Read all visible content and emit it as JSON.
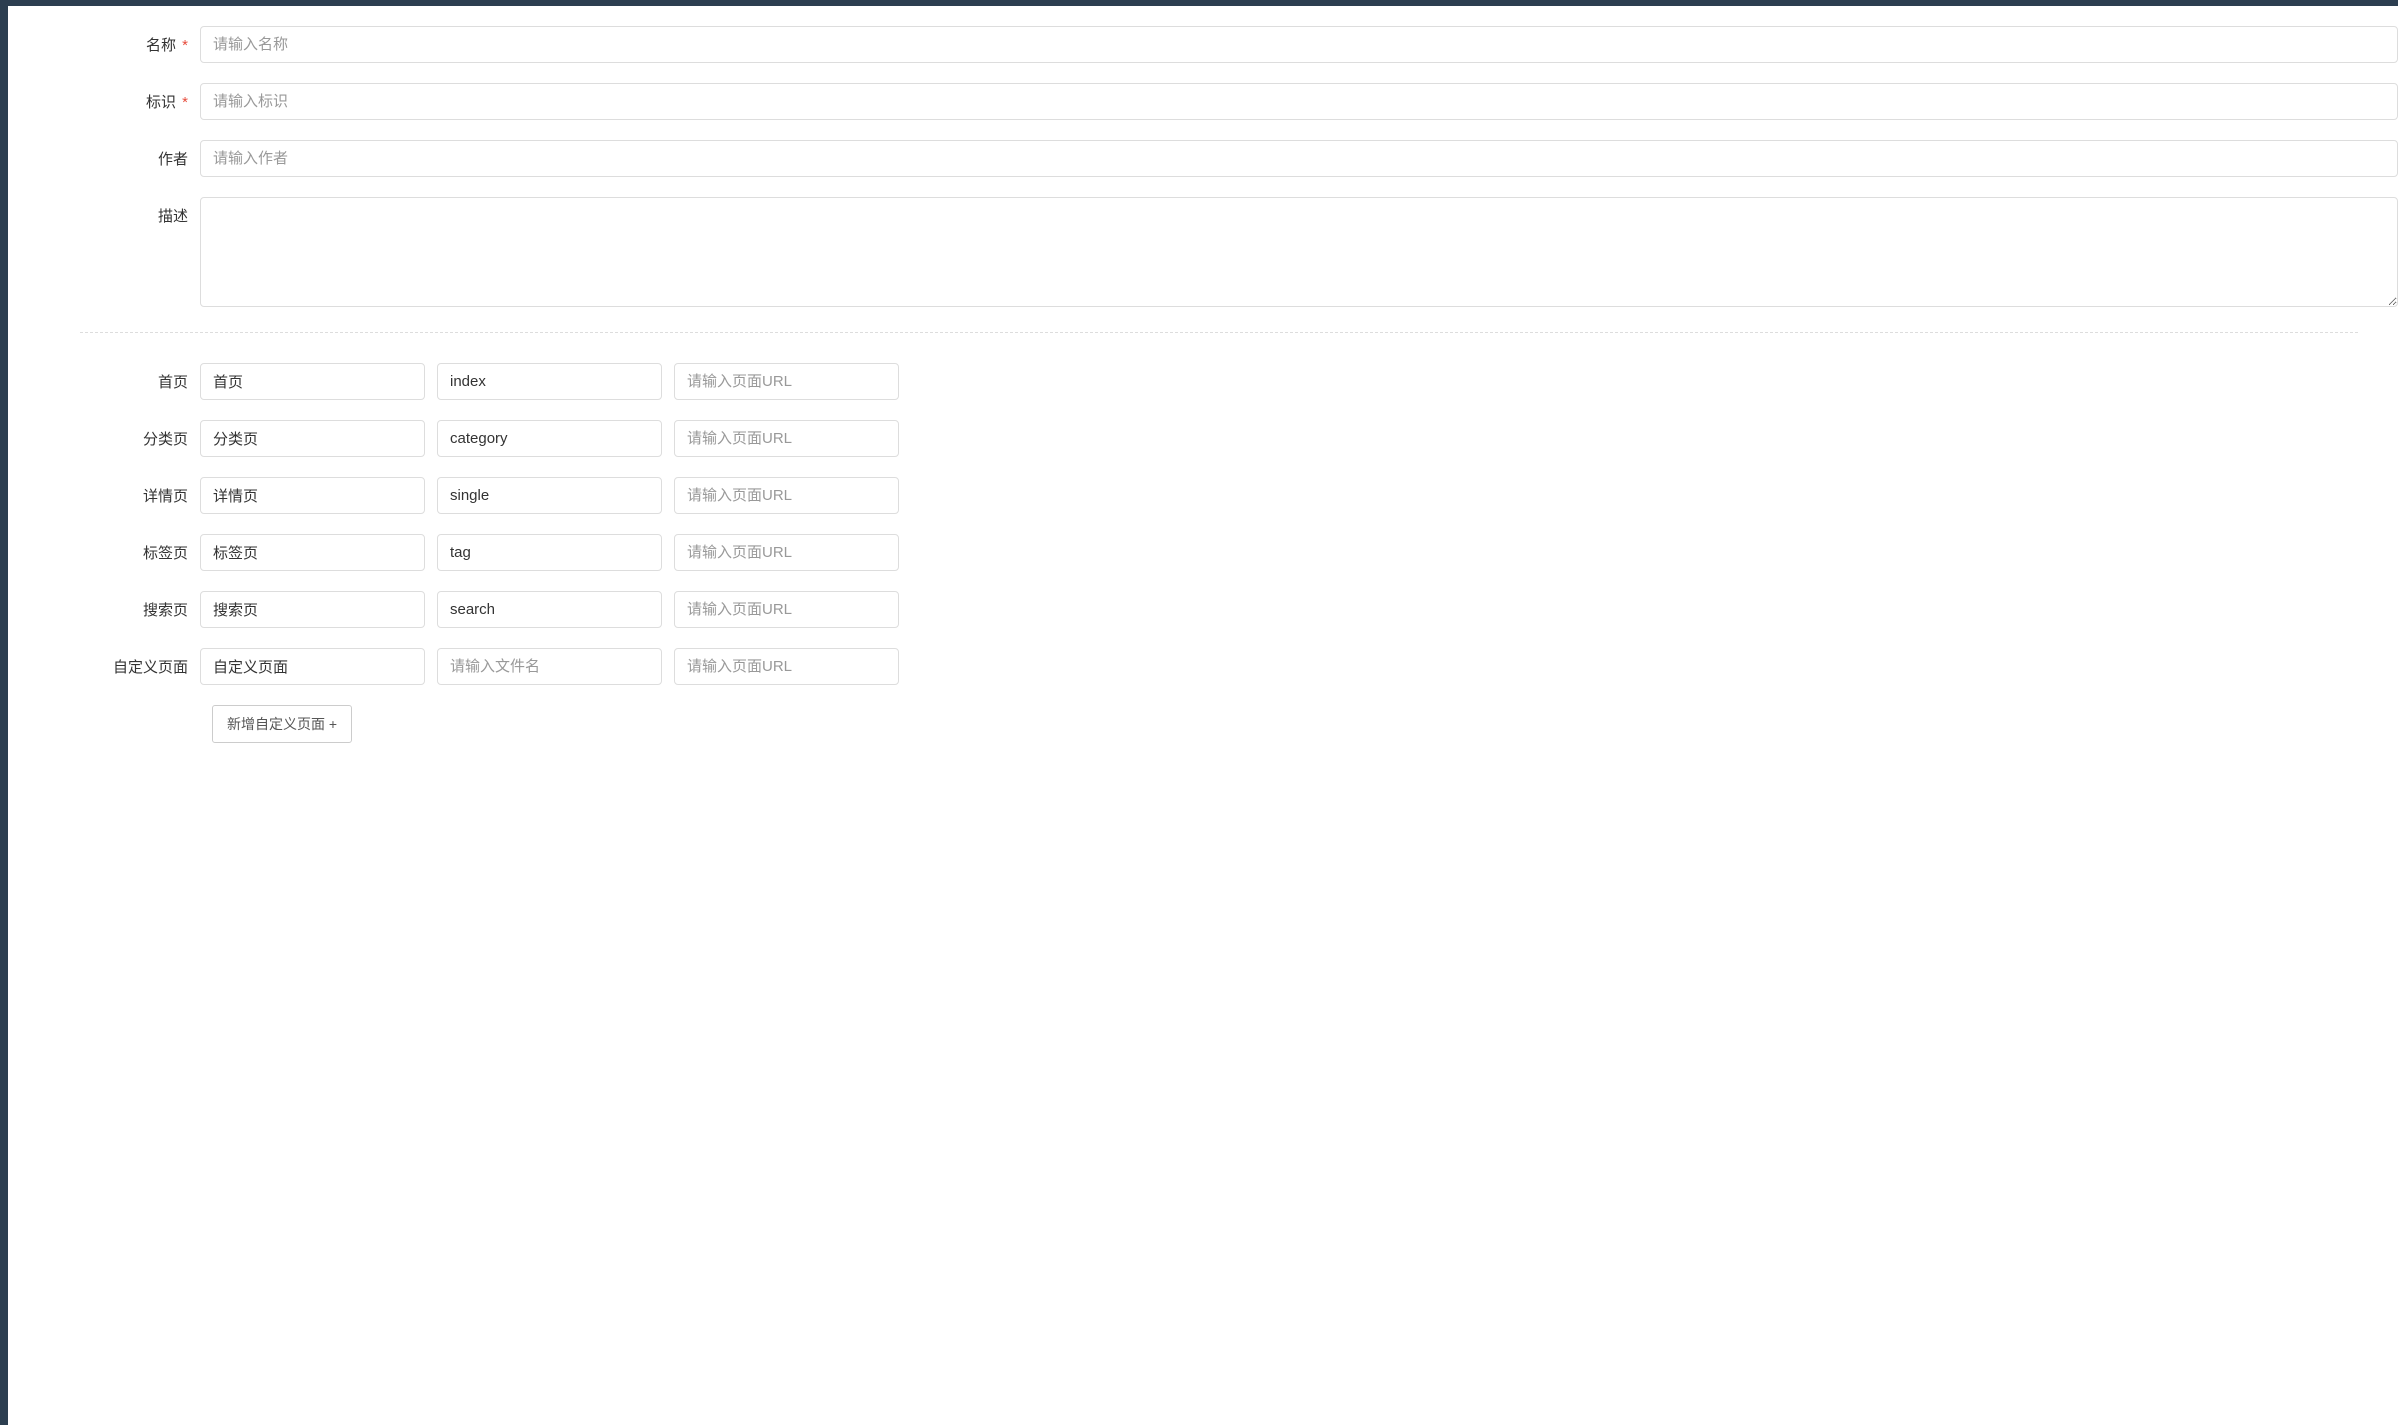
{
  "basic": {
    "name": {
      "label": "名称",
      "placeholder": "请输入名称",
      "required": true
    },
    "identifier": {
      "label": "标识",
      "placeholder": "请输入标识",
      "required": true
    },
    "author": {
      "label": "作者",
      "placeholder": "请输入作者",
      "required": false
    },
    "description": {
      "label": "描述",
      "placeholder": "",
      "required": false
    }
  },
  "pages": [
    {
      "label": "首页",
      "name_value": "首页",
      "file_value": "index",
      "url_value": "",
      "file_placeholder": "",
      "url_placeholder": "请输入页面URL"
    },
    {
      "label": "分类页",
      "name_value": "分类页",
      "file_value": "category",
      "url_value": "",
      "file_placeholder": "",
      "url_placeholder": "请输入页面URL"
    },
    {
      "label": "详情页",
      "name_value": "详情页",
      "file_value": "single",
      "url_value": "",
      "file_placeholder": "",
      "url_placeholder": "请输入页面URL"
    },
    {
      "label": "标签页",
      "name_value": "标签页",
      "file_value": "tag",
      "url_value": "",
      "file_placeholder": "",
      "url_placeholder": "请输入页面URL"
    },
    {
      "label": "搜索页",
      "name_value": "搜索页",
      "file_value": "search",
      "url_value": "",
      "file_placeholder": "",
      "url_placeholder": "请输入页面URL"
    },
    {
      "label": "自定义页面",
      "name_value": "自定义页面",
      "file_value": "",
      "url_value": "",
      "file_placeholder": "请输入文件名",
      "url_placeholder": "请输入页面URL"
    }
  ],
  "buttons": {
    "add_page": "新增自定义页面 +"
  },
  "required_marker": "*"
}
